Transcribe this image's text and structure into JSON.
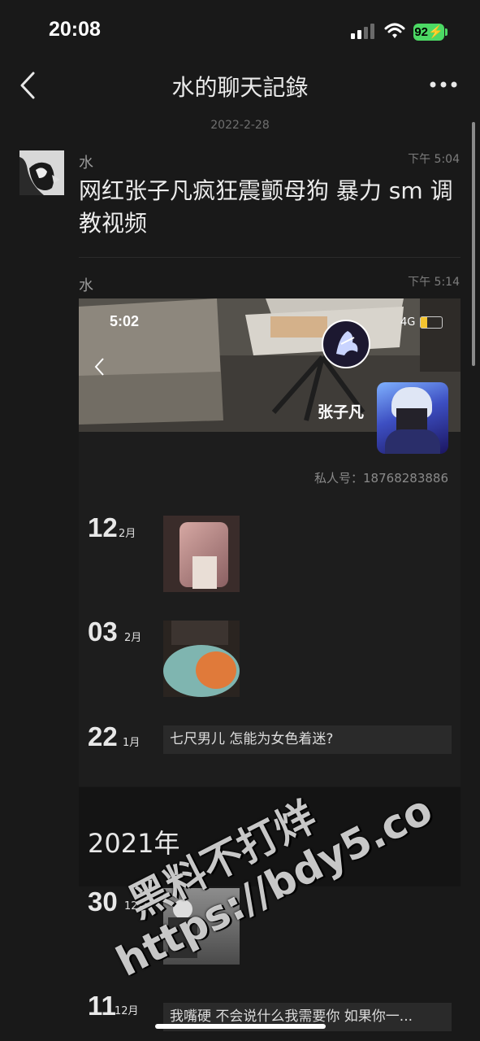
{
  "status": {
    "time": "20:08",
    "battery": "92"
  },
  "nav": {
    "title": "水的聊天記錄"
  },
  "date_label": "2022-2-28",
  "messages": [
    {
      "sender": "水",
      "time": "下午 5:04",
      "text": "网红张子凡疯狂震颤母狗 暴力 sm 调教视频"
    },
    {
      "sender": "水",
      "time": "下午 5:14"
    }
  ],
  "card": {
    "inner_time": "5:02",
    "inner_network": "4G",
    "profile_name": "张子凡",
    "private_number": "私人号：18768283886",
    "moments": [
      {
        "day": "12",
        "month": "2月",
        "type": "image"
      },
      {
        "day": "03",
        "month": "2月",
        "type": "image"
      },
      {
        "day": "22",
        "month": "1月",
        "type": "text",
        "text": "七尺男儿 怎能为女色着迷?"
      }
    ],
    "year": "2021年",
    "moments_2021": [
      {
        "day": "30",
        "month": "12月",
        "type": "image"
      },
      {
        "day": "11",
        "month": "12月",
        "type": "text",
        "text": "我嘴硬 不会说什么我需要你 如果你一..."
      }
    ]
  },
  "watermark": {
    "line1": "黑料不打烊",
    "line2": "https://bdy5.co"
  }
}
